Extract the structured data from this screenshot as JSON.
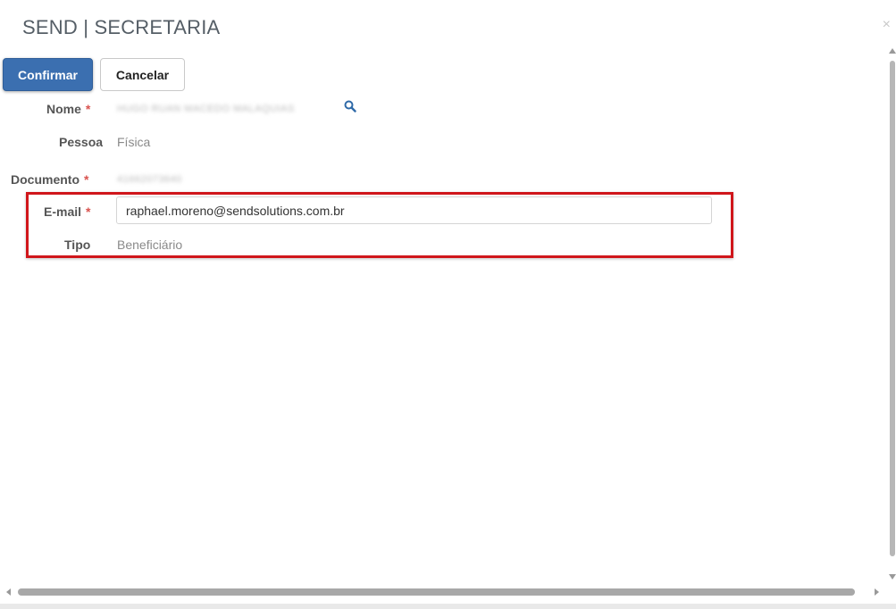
{
  "modal": {
    "title": "SEND | SECRETARIA",
    "close_label": "×"
  },
  "toolbar": {
    "confirm_label": "Confirmar",
    "cancel_label": "Cancelar"
  },
  "form": {
    "nome": {
      "label": "Nome",
      "required_mark": "*",
      "value": "HUGO RUAN MACEDO MALAQUIAS"
    },
    "pessoa": {
      "label": "Pessoa",
      "value": "Física"
    },
    "documento": {
      "label": "Documento",
      "required_mark": "*",
      "value": "41662073640"
    },
    "email": {
      "label": "E-mail",
      "required_mark": "*",
      "value": "raphael.moreno@sendsolutions.com.br"
    },
    "tipo": {
      "label": "Tipo",
      "value": "Beneficiário"
    }
  },
  "icons": {
    "search": "search-icon",
    "close": "close-icon"
  },
  "colors": {
    "primary": "#3b6fb0",
    "required": "#d9534f",
    "highlight": "#d0161b"
  }
}
